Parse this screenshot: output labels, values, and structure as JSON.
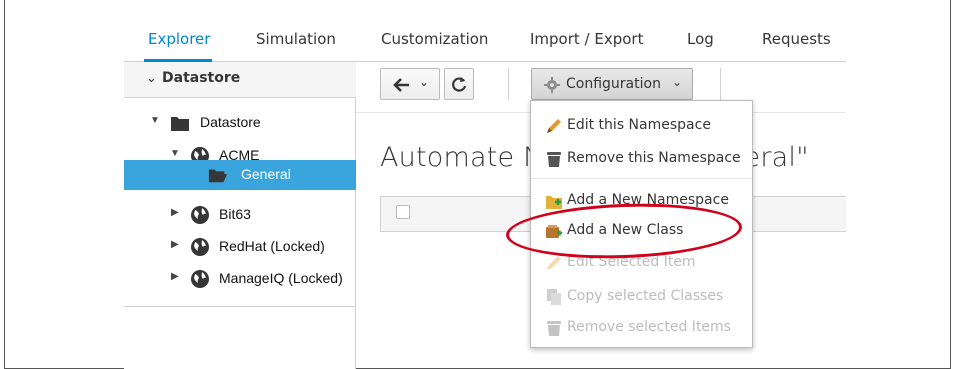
{
  "tabs": [
    {
      "label": "Explorer",
      "active": true
    },
    {
      "label": "Simulation"
    },
    {
      "label": "Customization"
    },
    {
      "label": "Import / Export"
    },
    {
      "label": "Log"
    },
    {
      "label": "Requests"
    }
  ],
  "sidebar": {
    "accordion_title": "Datastore",
    "tree": [
      {
        "label": "Datastore",
        "icon": "folder-icon",
        "expanded": true
      },
      {
        "label": "ACME",
        "icon": "globe-icon",
        "expanded": true
      },
      {
        "label": "General",
        "icon": "folder-open-icon",
        "selected": true
      },
      {
        "label": "Bit63",
        "icon": "globe-icon"
      },
      {
        "label": "RedHat (Locked)",
        "icon": "globe-icon"
      },
      {
        "label": "ManageIQ (Locked)",
        "icon": "globe-icon"
      }
    ]
  },
  "toolbar": {
    "back_icon": "arrow-left-icon",
    "refresh_icon": "refresh-icon",
    "config_label": "Configuration",
    "config_icon": "gear-icon"
  },
  "content": {
    "title_left": "Automate N",
    "title_right": "eral\""
  },
  "menu": {
    "items": [
      {
        "label": "Edit this Namespace",
        "icon": "pencil-icon",
        "enabled": true
      },
      {
        "label": "Remove this Namespace",
        "icon": "trash-icon",
        "enabled": true
      },
      {
        "label": "Add a New Namespace",
        "icon": "folder-add-icon",
        "enabled": true
      },
      {
        "label": "Add a New Class",
        "icon": "class-add-icon",
        "enabled": true,
        "highlighted": true
      },
      {
        "label": "Edit Selected Item",
        "icon": "pencil-icon",
        "enabled": false
      },
      {
        "label": "Copy selected Classes",
        "icon": "copy-icon",
        "enabled": false
      },
      {
        "label": "Remove selected Items",
        "icon": "trash-icon",
        "enabled": false
      }
    ]
  },
  "colors": {
    "accent": "#0088ce",
    "selected_row": "#39a5dc",
    "annotation": "#d0021b"
  }
}
